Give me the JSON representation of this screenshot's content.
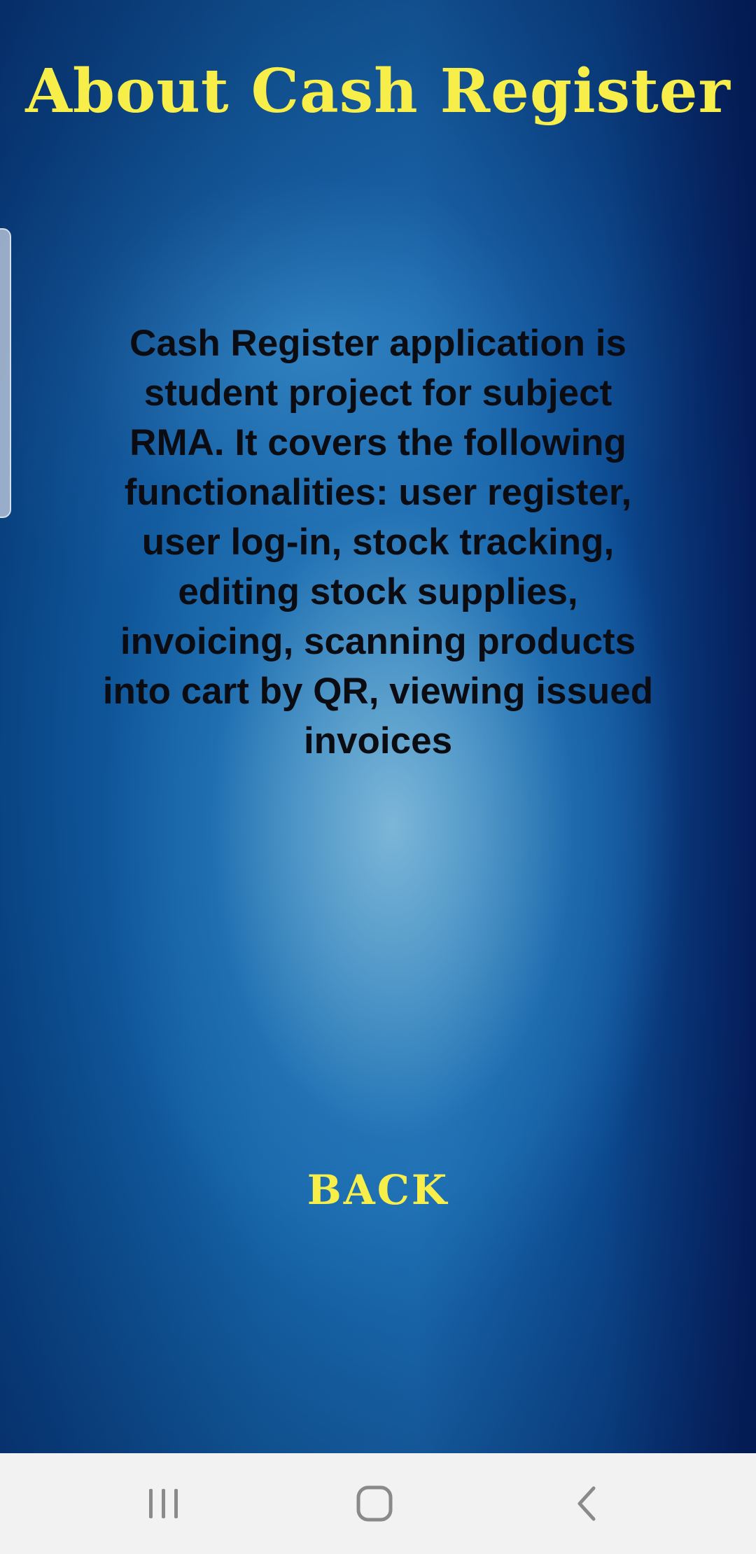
{
  "screen": {
    "title": "About Cash Register",
    "description": "Cash Register application is student project for subject RMA. It covers the following functionalities: user register, user log-in, stock tracking, editing stock supplies, invoicing, scanning products into cart by QR, viewing issued invoices",
    "back_label": "BACK"
  },
  "nav_bar": {
    "recent_icon": "recent-apps-icon",
    "home_icon": "home-icon",
    "back_icon": "back-chevron-icon"
  },
  "colors": {
    "title": "#f7ee4a",
    "back_button": "#f7ee4a",
    "description_text": "#0b0b12",
    "background_dark": "#051f5e",
    "background_light": "#7cb6d8",
    "nav_bar_background": "#f2f2f2",
    "nav_icon": "#8a8a8a"
  }
}
